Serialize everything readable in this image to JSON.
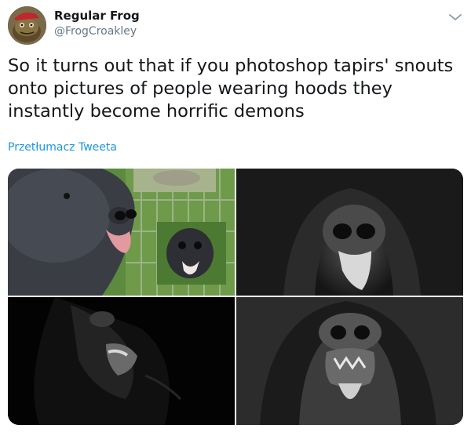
{
  "author": {
    "name": "Regular Frog",
    "handle": "@FrogCroakley",
    "avatar_icon": "frog-avatar-icon"
  },
  "menu": {
    "icon": "chevron-down-icon"
  },
  "tweet": {
    "text": "So it turns out that if you photoshop tapirs' snouts onto pictures of people wearing hoods they instantly become horrific demons",
    "translate_label": "Przetłumacz Tweeta"
  },
  "colors": {
    "text": "#14171a",
    "secondary": "#657786",
    "link": "#1b95e0"
  },
  "media": {
    "count": 4,
    "images": [
      {
        "subject": "tapir-photo"
      },
      {
        "subject": "hooded-figure-tapir"
      },
      {
        "subject": "dark-hooded-tapir"
      },
      {
        "subject": "grey-hooded-tapir"
      }
    ]
  }
}
